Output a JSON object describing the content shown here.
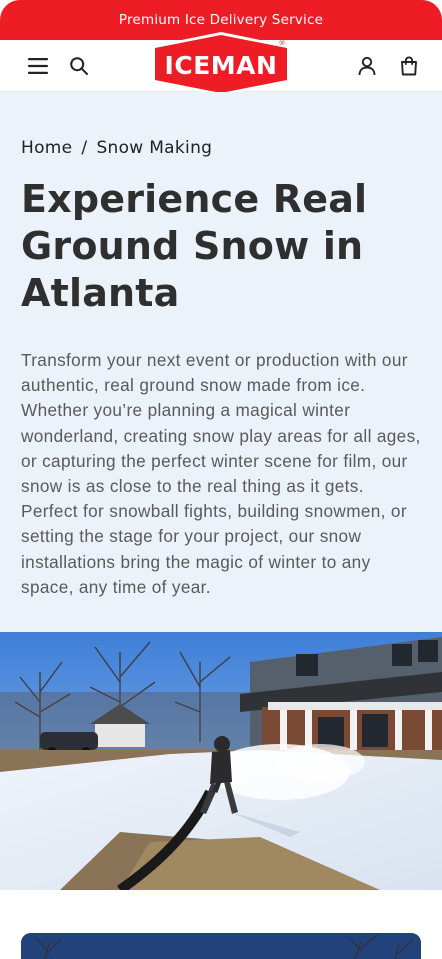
{
  "announcement": {
    "text": "Premium Ice Delivery Service"
  },
  "brand": {
    "logo_text": "ICEMAN",
    "registered_mark": "®",
    "color": "#ee1c25"
  },
  "header": {
    "icons": [
      "menu-icon",
      "search-icon",
      "account-icon",
      "cart-icon"
    ]
  },
  "breadcrumb": {
    "home": "Home",
    "separator": "/",
    "current": "Snow Making"
  },
  "hero": {
    "title": "Experience Real Ground Snow in Atlanta",
    "description": "Transform your next event or production with our authentic, real ground snow made from ice. Whether you’re planning a magical winter wonderland, creating snow play areas for all ages, or capturing the perfect winter scene for film, our snow is as close to the real thing as it gets. Perfect for snowball fights, building snowmen, or setting the stage for your project, our snow installations bring the magic of winter to any space, any time of year.",
    "background_color": "#ecf2fa"
  }
}
